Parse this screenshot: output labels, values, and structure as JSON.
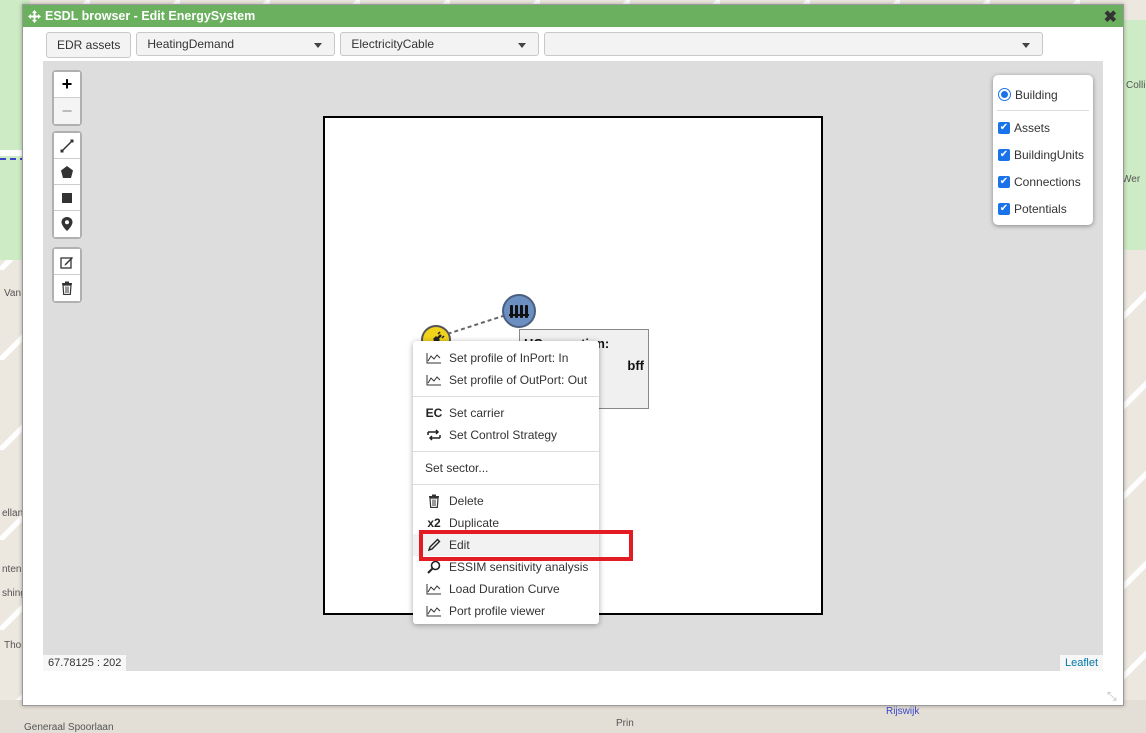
{
  "window": {
    "title": "ESDL browser - Edit EnergySystem"
  },
  "toolbar": {
    "edr_label": "EDR assets",
    "select1": "HeatingDemand",
    "select2": "ElectricityCable",
    "select3": ""
  },
  "layers": {
    "base": "Building",
    "overlays": [
      "Assets",
      "BuildingUnits",
      "Connections",
      "Potentials"
    ]
  },
  "tooltip": {
    "line1": "HConnection:",
    "line2": "bff"
  },
  "context_menu": {
    "items": [
      {
        "icon": "chart-icon",
        "label": "Set profile of InPort: In"
      },
      {
        "icon": "chart-icon",
        "label": "Set profile of OutPort: Out"
      },
      {
        "icon": "ec-icon",
        "label": "Set carrier",
        "glyph": "EC"
      },
      {
        "icon": "swap-icon",
        "label": "Set Control Strategy"
      },
      {
        "label": "Set sector..."
      },
      {
        "icon": "trash-icon",
        "label": "Delete"
      },
      {
        "icon": "duplicate-icon",
        "label": "Duplicate",
        "glyph": "x2"
      },
      {
        "icon": "pencil-icon",
        "label": "Edit"
      },
      {
        "icon": "search-icon",
        "label": "ESSIM sensitivity analysis"
      },
      {
        "icon": "chart-icon",
        "label": "Load Duration Curve"
      },
      {
        "icon": "chart-icon",
        "label": "Port profile viewer"
      }
    ]
  },
  "status": {
    "coordinates": "67.78125 : 202",
    "attribution": "Leaflet"
  },
  "map_labels": [
    "Van",
    "Wer",
    "Collinlaan",
    "ellan",
    "nten",
    "shing",
    "Thor",
    "Generaal Spoorlaan",
    "Rijswijk",
    "Prin"
  ],
  "colors": {
    "titlebar": "#6bb05f",
    "highlight": "#e31b23",
    "accent": "#1a73e8"
  }
}
